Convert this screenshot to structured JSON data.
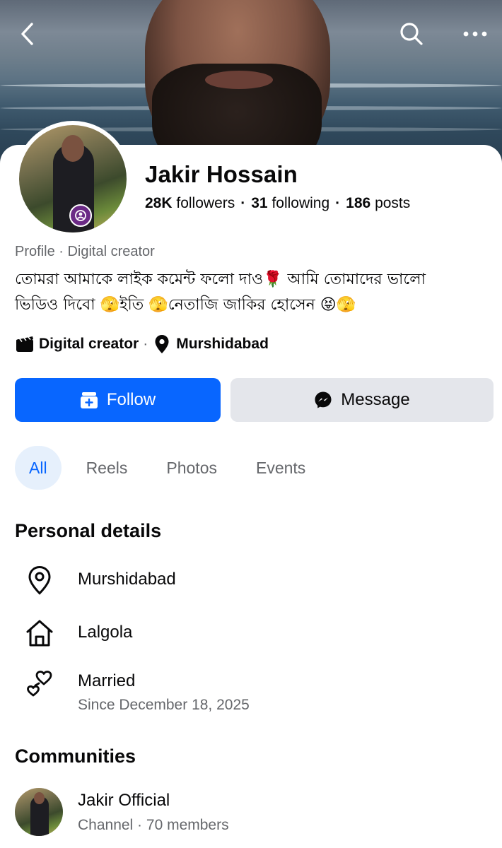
{
  "header": {
    "back_icon": "chevron-left-icon",
    "search_icon": "search-icon",
    "more_icon": "more-horizontal-icon"
  },
  "profile": {
    "name": "Jakir Hossain",
    "followers_count": "28K",
    "followers_label": "followers",
    "following_count": "31",
    "following_label": "following",
    "posts_count": "186",
    "posts_label": "posts",
    "type_line": "Profile · Digital creator",
    "bio_line1": "তোমরা আমাকে লাইক কমেন্ট ফলো দাও🌹 আমি তোমাদের ভালো",
    "bio_line2": "ভিডিও দিবো 🫣ইতি 🫣নেতাজি জাকির হোসেন 😝🫣",
    "category": "Digital creator",
    "location": "Murshidabad",
    "accent_color": "#0866ff",
    "badge_color": "#6b2a86"
  },
  "actions": {
    "follow_label": "Follow",
    "message_label": "Message"
  },
  "tabs": [
    {
      "label": "All",
      "active": true
    },
    {
      "label": "Reels",
      "active": false
    },
    {
      "label": "Photos",
      "active": false
    },
    {
      "label": "Events",
      "active": false
    }
  ],
  "personal_details": {
    "title": "Personal details",
    "items": [
      {
        "icon": "location-pin-icon",
        "text": "Murshidabad"
      },
      {
        "icon": "home-icon",
        "text": "Lalgola"
      },
      {
        "icon": "hearts-icon",
        "text": "Married",
        "sub": "Since December 18, 2025"
      }
    ]
  },
  "communities": {
    "title": "Communities",
    "items": [
      {
        "name": "Jakir Official",
        "meta": "Channel · 70 members"
      }
    ]
  }
}
